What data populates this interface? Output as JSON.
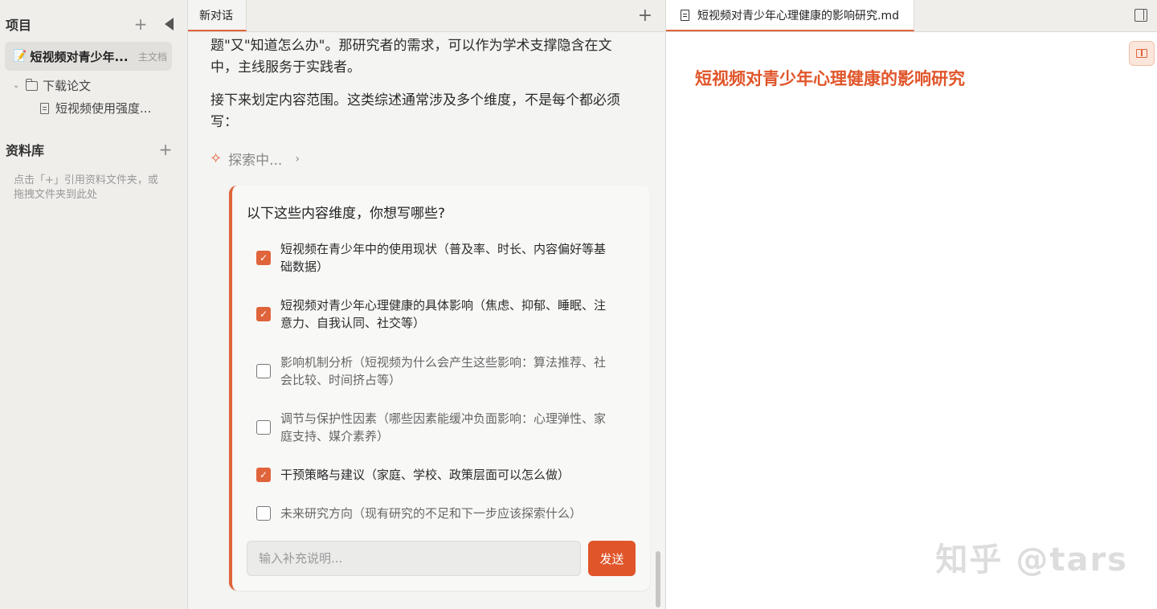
{
  "sidebar": {
    "projects_title": "项目",
    "project": {
      "emoji": "📝",
      "name": "短视频对青少年...",
      "tag": "主文档"
    },
    "folder": {
      "name": "下载论文"
    },
    "file": {
      "name": "短视频使用强度..."
    },
    "library_title": "资料库",
    "library_hint": "点击「+」引用资料文件夹，或拖拽文件夹到此处"
  },
  "chat": {
    "tab_label": "新对话",
    "para1": "题\"又\"知道怎么办\"。那研究者的需求，可以作为学术支撑隐含在文中，主线服务于实践者。",
    "para2": "接下来划定内容范围。这类综述通常涉及多个维度，不是每个都必须写：",
    "exploring": "探索中...",
    "card": {
      "question": "以下这些内容维度，你想写哪些?",
      "options": [
        {
          "label": "短视频在青少年中的使用现状（普及率、时长、内容偏好等基础数据）",
          "checked": true
        },
        {
          "label": "短视频对青少年心理健康的具体影响（焦虑、抑郁、睡眠、注意力、自我认同、社交等）",
          "checked": true
        },
        {
          "label": "影响机制分析（短视频为什么会产生这些影响：算法推荐、社会比较、时间挤占等）",
          "checked": false
        },
        {
          "label": "调节与保护性因素（哪些因素能缓冲负面影响：心理弹性、家庭支持、媒介素养）",
          "checked": false
        },
        {
          "label": "干预策略与建议（家庭、学校、政策层面可以怎么做）",
          "checked": true
        },
        {
          "label": "未来研究方向（现有研究的不足和下一步应该探索什么）",
          "checked": false
        }
      ],
      "input_placeholder": "输入补充说明...",
      "input_value": "",
      "send_label": "发送"
    }
  },
  "doc": {
    "tab_label": "短视频对青少年心理健康的影响研究.md",
    "title": "短视频对青少年心理健康的影响研究",
    "watermark": "知乎 @tars"
  },
  "colors": {
    "accent": "#e0643b",
    "send": "#e0552a"
  },
  "icons": [
    "plus-icon",
    "collapse-sidebar-icon",
    "chevron-down-icon",
    "folder-icon",
    "file-icon",
    "sparkle-icon",
    "chevron-right-icon",
    "markdown-file-icon",
    "split-view-icon",
    "book-icon"
  ]
}
